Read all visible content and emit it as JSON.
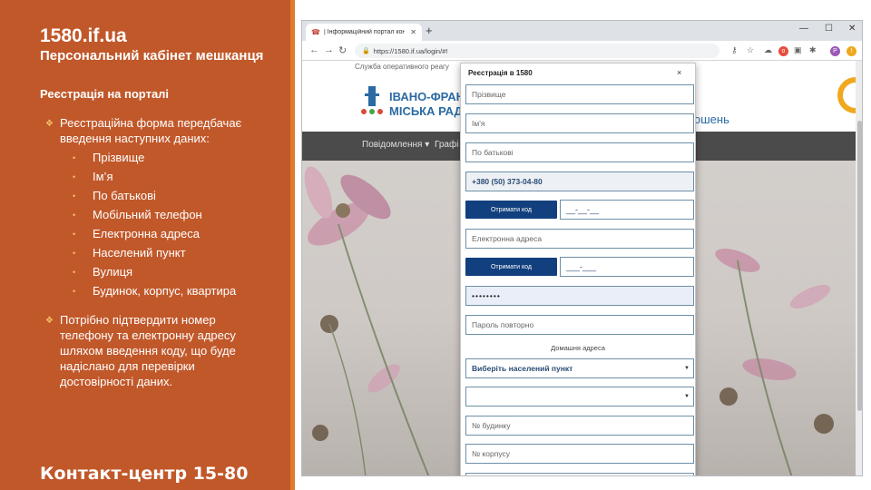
{
  "slide": {
    "title": "1580.if.ua",
    "subtitle": "Персональний  кабінет мешканця",
    "section": "Реєстрація на порталі",
    "para1": "Реєстраційна форма передбачає введення наступних даних:",
    "items": [
      "Прізвище",
      "Ім’я",
      "По батькові",
      "Мобільний телефон",
      "Електронна адреса",
      "Населений пункт",
      "Вулиця",
      "Будинок, корпус, квартира"
    ],
    "para2": "Потрібно підтвердити номер телефону та електронну адресу шляхом введення коду, що буде надіслано для перевірки достовірності даних.",
    "contact": "Контакт-центр 15-80"
  },
  "browser": {
    "tab_title": "| Інформаційний портал контак",
    "url": "https://1580.if.ua/login/#!",
    "profile_initial": "P"
  },
  "site": {
    "service": "Служба оперативного реагу",
    "city_line1": "ІВАНО-ФРАНК",
    "city_line2": "МІСЬКА РАДА",
    "header_right": "ошень",
    "nav": [
      "Повідомлення ▾",
      "Графі"
    ]
  },
  "modal": {
    "title": "Реєстрація в 1580",
    "close": "×",
    "surname_placeholder": "Прізвище",
    "name_placeholder": "Ім'я",
    "patronymic_placeholder": "По батькові",
    "phone_value": "+380 (50) 373-04-80",
    "get_code_label": "Отримати код",
    "phone_code_mask": "__-__-__",
    "email_placeholder": "Електронна адреса",
    "email_code_mask": "___-___",
    "password_value": "••••••••",
    "password_repeat_placeholder": "Пароль повторно",
    "home_address_label": "Домашня адреса",
    "settlement_select": "Виберіть населений пункт",
    "street_select": "",
    "house_placeholder": "№ будинку",
    "building_placeholder": "№ корпусу"
  },
  "colors": {
    "panel": "#c1582a",
    "accent": "#f3c262",
    "button": "#123f7e"
  }
}
